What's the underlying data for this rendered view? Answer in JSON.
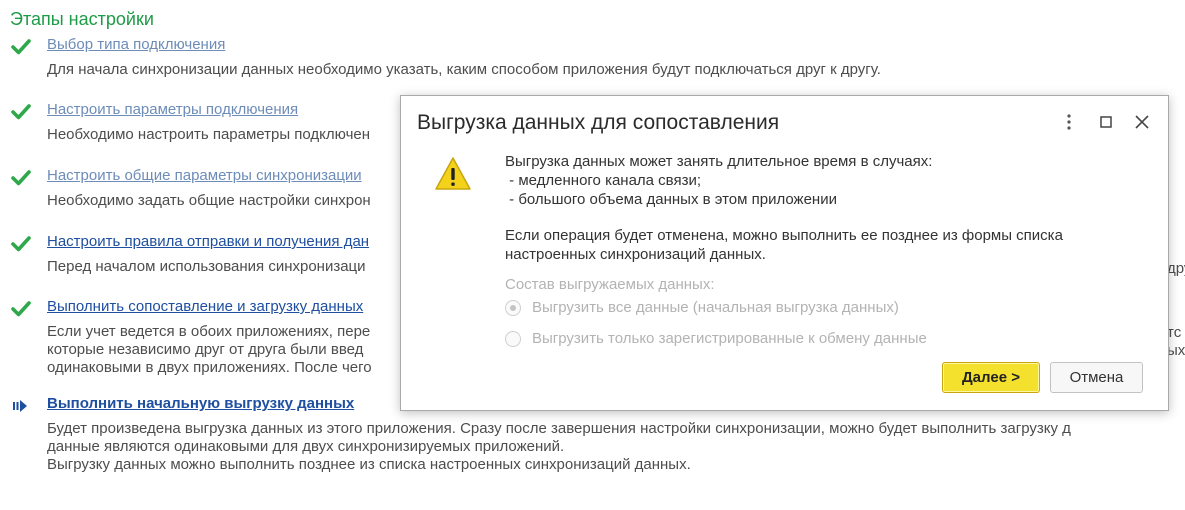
{
  "page": {
    "title": "Этапы настройки"
  },
  "steps": [
    {
      "status": "done",
      "link": "Выбор типа подключения",
      "desc": [
        "Для начала синхронизации данных необходимо указать, каким способом приложения будут подключаться друг к другу."
      ]
    },
    {
      "status": "done",
      "link": "Настроить параметры подключения",
      "desc": [
        "Необходимо настроить параметры подключен"
      ]
    },
    {
      "status": "done",
      "link": "Настроить общие параметры синхронизации",
      "desc": [
        "Необходимо задать общие настройки синхрон"
      ]
    },
    {
      "status": "done",
      "link": "Настроить правила отправки и получения дан",
      "desc": [
        "Перед началом использования синхронизаци"
      ]
    },
    {
      "status": "done",
      "link": "Выполнить сопоставление и загрузку данных",
      "desc": [
        "Если учет ведется в обоих приложениях, пере",
        "которые независимо друг от друга были введ",
        "одинаковыми в двух приложениях. После чего"
      ]
    },
    {
      "status": "current",
      "link": "Выполнить начальную выгрузку данных",
      "desc": [
        "Будет произведена выгрузка данных из этого приложения. Сразу после завершения настройки синхронизации, можно будет выполнить загрузку д",
        "данные являются одинаковыми для двух синхронизируемых приложений.",
        "Выгрузку данных можно выполнить позднее из списка настроенных синхронизаций данных."
      ]
    }
  ],
  "edge_fragments": {
    "step4": "дру",
    "step5a": "тс",
    "step5b": "ых"
  },
  "dialog": {
    "title": "Выгрузка данных для сопоставления",
    "warning_lines": [
      "Выгрузка данных может занять длительное время в случаях:",
      " - медленного канала связи;",
      " - большого объема данных в этом приложении"
    ],
    "cancel_note_lines": [
      "Если операция будет отменена, можно выполнить ее позднее из формы списка",
      "настроенных синхронизаций данных."
    ],
    "section_label": "Состав выгружаемых данных:",
    "options": [
      {
        "label": "Выгрузить все данные (начальная выгрузка данных)",
        "selected": true
      },
      {
        "label": "Выгрузить только зарегистрированные к обмену данные",
        "selected": false
      }
    ],
    "next_button": "Далее >",
    "cancel_button": "Отмена"
  },
  "colors": {
    "title_green": "#1e9b46",
    "check_green": "#2ea84a",
    "link_done": "#6d8cb8",
    "link_active": "#1e4fa0",
    "primary_button": "#f4e12e",
    "warning_yellow": "#f4d21a"
  },
  "icons": {
    "step_done": "checkmark-icon",
    "step_current": "current-step-arrow-icon",
    "dialog_warning": "warning-icon",
    "more": "more-vertical-icon",
    "maximize": "maximize-icon",
    "close": "close-icon"
  }
}
